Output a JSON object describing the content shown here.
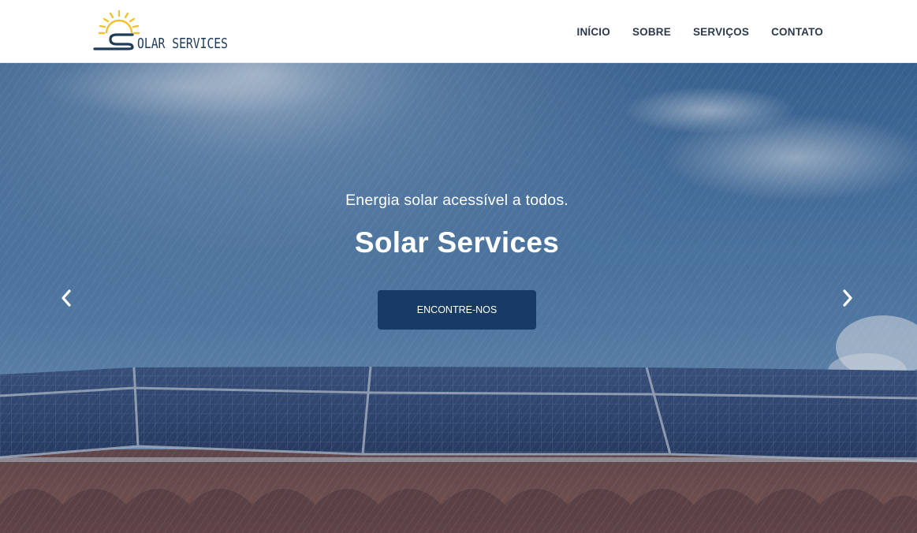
{
  "header": {
    "logo_text": "SOLAR SERVICES",
    "nav": [
      {
        "label": "INÍCIO"
      },
      {
        "label": "SOBRE"
      },
      {
        "label": "SERVIÇOS"
      },
      {
        "label": "CONTATO"
      }
    ]
  },
  "hero": {
    "tagline": "Energia solar acessível a todos.",
    "title": "Solar Services",
    "cta_label": "ENCONTRE-NOS",
    "prev_label": "Previous",
    "next_label": "Next"
  },
  "colors": {
    "nav_text": "#2c3a4b",
    "logo_sun": "#f2c12e",
    "logo_text": "#1e3b5a",
    "cta_bg": "#173b66",
    "hero_text": "#ffffff"
  },
  "icons": [
    "sun-logo-icon",
    "chevron-left-icon",
    "chevron-right-icon"
  ]
}
